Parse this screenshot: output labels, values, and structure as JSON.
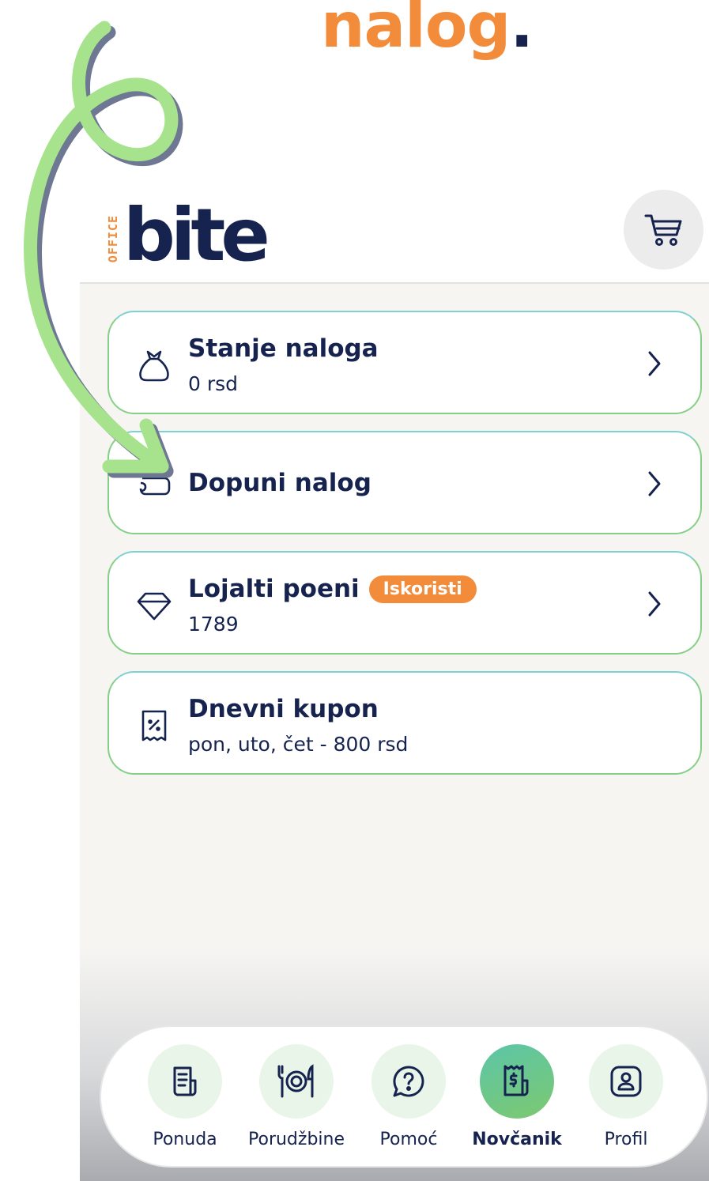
{
  "headline": {
    "word": "nalog",
    "dot": "."
  },
  "logo": {
    "small": "OFFICE",
    "main": "bite"
  },
  "cards": [
    {
      "title": "Stanje naloga",
      "subtitle": "0 rsd",
      "icon": "money-bag-icon"
    },
    {
      "title": "Dopuni nalog",
      "icon": "wallet-icon"
    },
    {
      "title": "Lojalti poeni",
      "badge": "Iskoristi",
      "subtitle": "1789",
      "icon": "diamond-icon"
    },
    {
      "title": "Dnevni kupon",
      "subtitle": "pon, uto, čet - 800 rsd",
      "icon": "coupon-icon"
    }
  ],
  "nav": [
    {
      "label": "Ponuda",
      "icon": "menu-icon"
    },
    {
      "label": "Porudžbine",
      "icon": "plate-icon"
    },
    {
      "label": "Pomoć",
      "icon": "help-icon"
    },
    {
      "label": "Novčanik",
      "icon": "wallet-receipt-icon",
      "active": true
    },
    {
      "label": "Profil",
      "icon": "profile-icon"
    }
  ],
  "colors": {
    "accent": "#f28c3a",
    "navy": "#16234f",
    "green": "#7cc870",
    "arrow": "#a6e38c"
  }
}
